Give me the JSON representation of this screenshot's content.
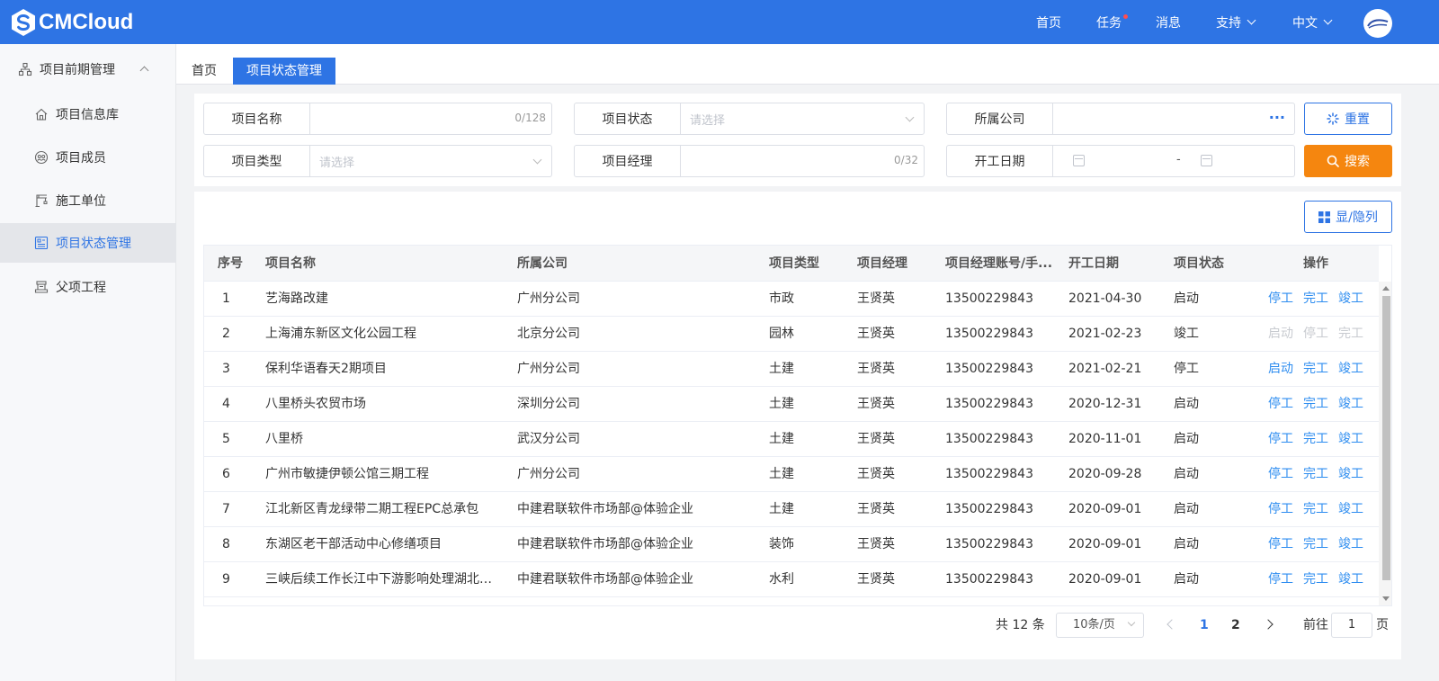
{
  "brand": {
    "name": "CMCloud"
  },
  "topnav": {
    "home": "首页",
    "tasks": "任务",
    "messages": "消息",
    "support": "支持",
    "language": "中文"
  },
  "sidebar": {
    "group": "项目前期管理",
    "items": [
      {
        "label": "项目信息库",
        "icon": "home-icon"
      },
      {
        "label": "项目成员",
        "icon": "members-icon"
      },
      {
        "label": "施工单位",
        "icon": "crane-icon"
      },
      {
        "label": "项目状态管理",
        "icon": "status-icon",
        "active": true
      },
      {
        "label": "父项工程",
        "icon": "project-icon"
      }
    ]
  },
  "tabs": [
    {
      "label": "首页"
    },
    {
      "label": "项目状态管理",
      "active": true
    }
  ],
  "filters": {
    "project_name": {
      "label": "项目名称",
      "count": "0/128"
    },
    "project_status": {
      "label": "项目状态",
      "placeholder": "请选择"
    },
    "company": {
      "label": "所属公司",
      "more": "···"
    },
    "project_type": {
      "label": "项目类型",
      "placeholder": "请选择"
    },
    "manager": {
      "label": "项目经理",
      "count": "0/32"
    },
    "start_date": {
      "label": "开工日期",
      "separator": "-"
    }
  },
  "buttons": {
    "reset": "重置",
    "search": "搜索",
    "columns": "显/隐列"
  },
  "colors": {
    "primary": "#2e74e4",
    "accent": "#f5860f",
    "link": "#2e8df0"
  },
  "table": {
    "headers": [
      "序号",
      "项目名称",
      "所属公司",
      "项目类型",
      "项目经理",
      "项目经理账号/手...",
      "开工日期",
      "项目状态",
      "操作"
    ],
    "rows": [
      {
        "no": "1",
        "name": "艺海路改建",
        "company": "广州分公司",
        "type": "市政",
        "manager": "王贤英",
        "account": "13500229843",
        "date": "2021-04-30",
        "status": "启动",
        "ops": [
          {
            "label": "停工",
            "disabled": false
          },
          {
            "label": "完工",
            "disabled": false
          },
          {
            "label": "竣工",
            "disabled": false
          }
        ]
      },
      {
        "no": "2",
        "name": "上海浦东新区文化公园工程",
        "company": "北京分公司",
        "type": "园林",
        "manager": "王贤英",
        "account": "13500229843",
        "date": "2021-02-23",
        "status": "竣工",
        "ops": [
          {
            "label": "启动",
            "disabled": true
          },
          {
            "label": "停工",
            "disabled": true
          },
          {
            "label": "完工",
            "disabled": true
          }
        ]
      },
      {
        "no": "3",
        "name": "保利华语春天2期项目",
        "company": "广州分公司",
        "type": "土建",
        "manager": "王贤英",
        "account": "13500229843",
        "date": "2021-02-21",
        "status": "停工",
        "ops": [
          {
            "label": "启动",
            "disabled": false
          },
          {
            "label": "完工",
            "disabled": false
          },
          {
            "label": "竣工",
            "disabled": false
          }
        ]
      },
      {
        "no": "4",
        "name": "八里桥头农贸市场",
        "company": "深圳分公司",
        "type": "土建",
        "manager": "王贤英",
        "account": "13500229843",
        "date": "2020-12-31",
        "status": "启动",
        "ops": [
          {
            "label": "停工",
            "disabled": false
          },
          {
            "label": "完工",
            "disabled": false
          },
          {
            "label": "竣工",
            "disabled": false
          }
        ]
      },
      {
        "no": "5",
        "name": "八里桥",
        "company": "武汉分公司",
        "type": "土建",
        "manager": "王贤英",
        "account": "13500229843",
        "date": "2020-11-01",
        "status": "启动",
        "ops": [
          {
            "label": "停工",
            "disabled": false
          },
          {
            "label": "完工",
            "disabled": false
          },
          {
            "label": "竣工",
            "disabled": false
          }
        ]
      },
      {
        "no": "6",
        "name": "广州市敏捷伊顿公馆三期工程",
        "company": "广州分公司",
        "type": "土建",
        "manager": "王贤英",
        "account": "13500229843",
        "date": "2020-09-28",
        "status": "启动",
        "ops": [
          {
            "label": "停工",
            "disabled": false
          },
          {
            "label": "完工",
            "disabled": false
          },
          {
            "label": "竣工",
            "disabled": false
          }
        ]
      },
      {
        "no": "7",
        "name": "江北新区青龙绿带二期工程EPC总承包",
        "company": "中建君联软件市场部@体验企业",
        "type": "土建",
        "manager": "王贤英",
        "account": "13500229843",
        "date": "2020-09-01",
        "status": "启动",
        "ops": [
          {
            "label": "停工",
            "disabled": false
          },
          {
            "label": "完工",
            "disabled": false
          },
          {
            "label": "竣工",
            "disabled": false
          }
        ]
      },
      {
        "no": "8",
        "name": "东湖区老干部活动中心修缮项目",
        "company": "中建君联软件市场部@体验企业",
        "type": "装饰",
        "manager": "王贤英",
        "account": "13500229843",
        "date": "2020-09-01",
        "status": "启动",
        "ops": [
          {
            "label": "停工",
            "disabled": false
          },
          {
            "label": "完工",
            "disabled": false
          },
          {
            "label": "竣工",
            "disabled": false
          }
        ]
      },
      {
        "no": "9",
        "name": "三峡后续工作长江中下游影响处理湖北荆...",
        "company": "中建君联软件市场部@体验企业",
        "type": "水利",
        "manager": "王贤英",
        "account": "13500229843",
        "date": "2020-09-01",
        "status": "启动",
        "ops": [
          {
            "label": "停工",
            "disabled": false
          },
          {
            "label": "完工",
            "disabled": false
          },
          {
            "label": "竣工",
            "disabled": false
          }
        ]
      }
    ]
  },
  "pagination": {
    "total": "共 12 条",
    "page_size": "10条/页",
    "pages": [
      "1",
      "2"
    ],
    "current": "1",
    "goto_label": "前往",
    "goto_value": "1",
    "goto_suffix": "页"
  }
}
